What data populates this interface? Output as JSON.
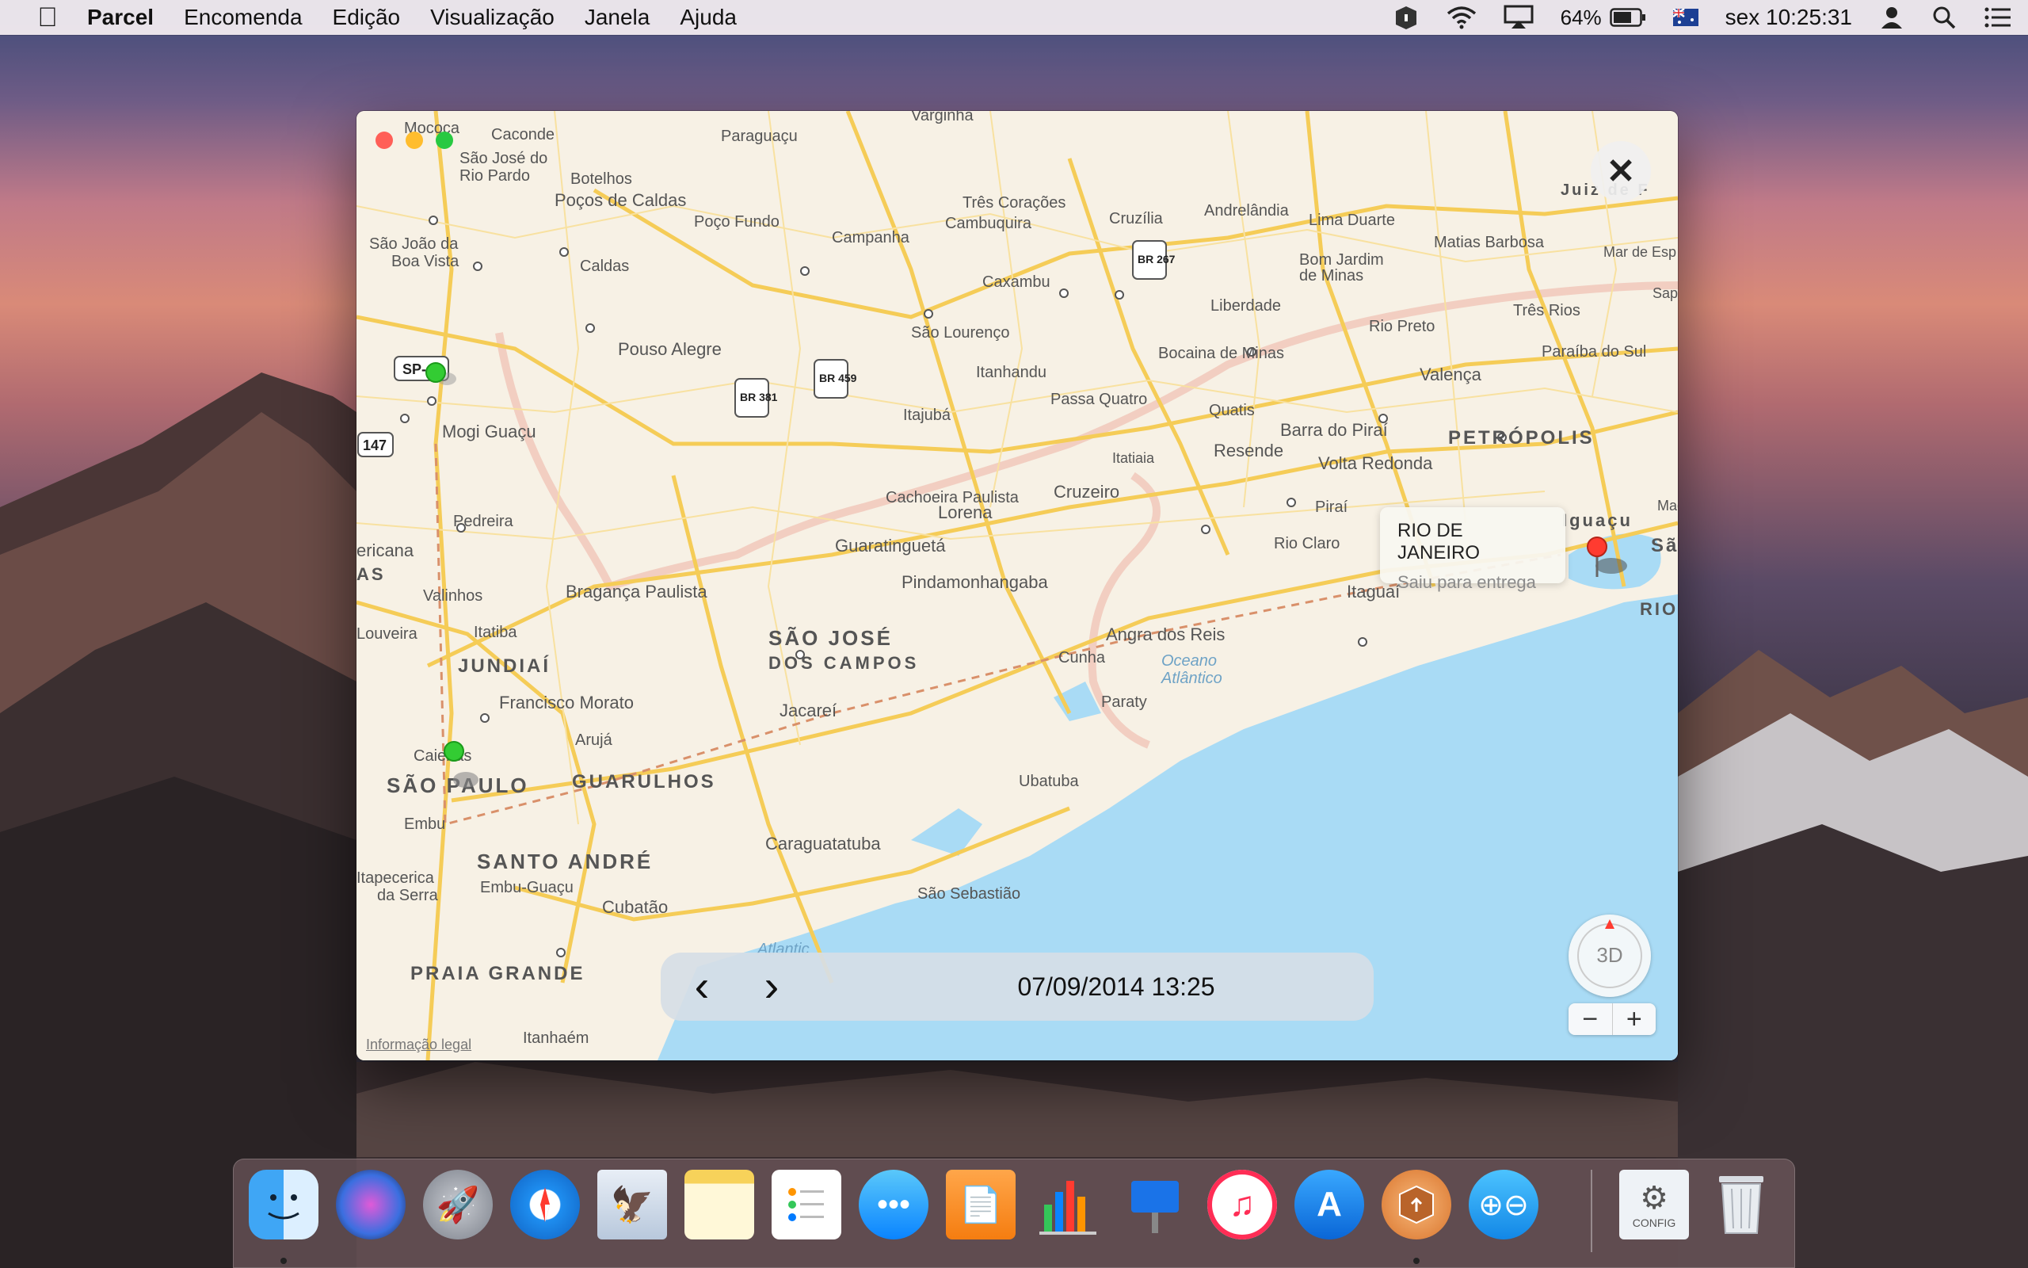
{
  "menubar": {
    "apple_icon": "apple-icon",
    "items": [
      "Parcel",
      "Encomenda",
      "Edição",
      "Visualização",
      "Janela",
      "Ajuda"
    ],
    "battery": "64%",
    "clock": "sex 10:25:31"
  },
  "window": {
    "close_glyph": "✕",
    "tooltip": {
      "title": "RIO DE JANEIRO",
      "subtitle": "Saiu para entrega"
    },
    "nav": {
      "prev": "‹",
      "next": "›",
      "date": "07/09/2014 13:25"
    },
    "compass_label": "3D",
    "zoom": {
      "out": "−",
      "in": "+"
    },
    "legal": "Informação legal",
    "map_labels": [
      "Varginha",
      "Paraguaçu",
      "Mococa",
      "Caconde",
      "São José do",
      "Rio Pardo",
      "Botelhos",
      "Poços de Caldas",
      "Três Corações",
      "Cruzília",
      "Andrelândia",
      "Lima Duarte",
      "Poço Fundo",
      "Cambuquira",
      "Campanha",
      "Matias Barbosa",
      "São João da",
      "Boa Vista",
      "Caldas",
      "Caxambu",
      "Bom Jardim",
      "de Minas",
      "Liberdade",
      "Três Rios",
      "Rio Preto",
      "São Lourenço",
      "Pouso Alegre",
      "Bocaina de Minas",
      "Paraíba do Sul",
      "Itanhandu",
      "Valença",
      "Mogi Guaçu",
      "Itajubá",
      "Passa Quatro",
      "Quatis",
      "Barra do Piraí",
      "PETRÓPOLIS",
      "Itatiaia",
      "Resende",
      "Volta Redonda",
      "Cachoeira Paulista",
      "Cruzeiro",
      "Pedreira",
      "Lorena",
      "Piraí",
      "Rio Claro",
      "Guaratinguetá",
      "Pindamonhangaba",
      "Itaguaí",
      "RIO DE",
      "Valinhos",
      "Bragança Paulista",
      "Louveira",
      "Itatiba",
      "SÃO JOSÉ",
      "DOS CAMPOS",
      "Angra dos Reis",
      "JUNDIAÍ",
      "Cunha",
      "Oceano",
      "Atlântico",
      "Francisco Morato",
      "Jacareí",
      "Paraty",
      "Arujá",
      "Caieiras",
      "SÃO PAULO",
      "GUARULHOS",
      "Ubatuba",
      "Embu",
      "SANTO ANDRÉ",
      "Caraguatatuba",
      "Itapecerica",
      "da Serra",
      "Embu-Guaçu",
      "Cubatão",
      "São Sebastião",
      "PRAIA GRANDE",
      "Atlantic",
      "Itanhaém",
      "SP-",
      "147",
      "BR 381",
      "BR 459",
      "BR 267",
      "Juiz de F",
      "Mar de Esp",
      "Sap",
      "Mag",
      "São",
      "Iguaçu",
      "ericana",
      "AS"
    ]
  },
  "dock": {
    "icons": [
      "finder-icon",
      "siri-icon",
      "launchpad-icon",
      "safari-icon",
      "mail-icon",
      "notes-icon",
      "reminders-icon",
      "messages-icon",
      "pages-icon",
      "numbers-icon",
      "keynote-icon",
      "itunes-icon",
      "app-store-icon",
      "parcel-icon",
      "screen-sharing-icon",
      "config-icon",
      "trash-icon"
    ],
    "config_label": "CONFIG"
  },
  "colors": {
    "land": "#f7f1e5",
    "water": "#a9dbf5",
    "road": "#f5cc57",
    "border": "#f0c6b8",
    "route": "#d9906a",
    "accent": "#ff3b30"
  }
}
